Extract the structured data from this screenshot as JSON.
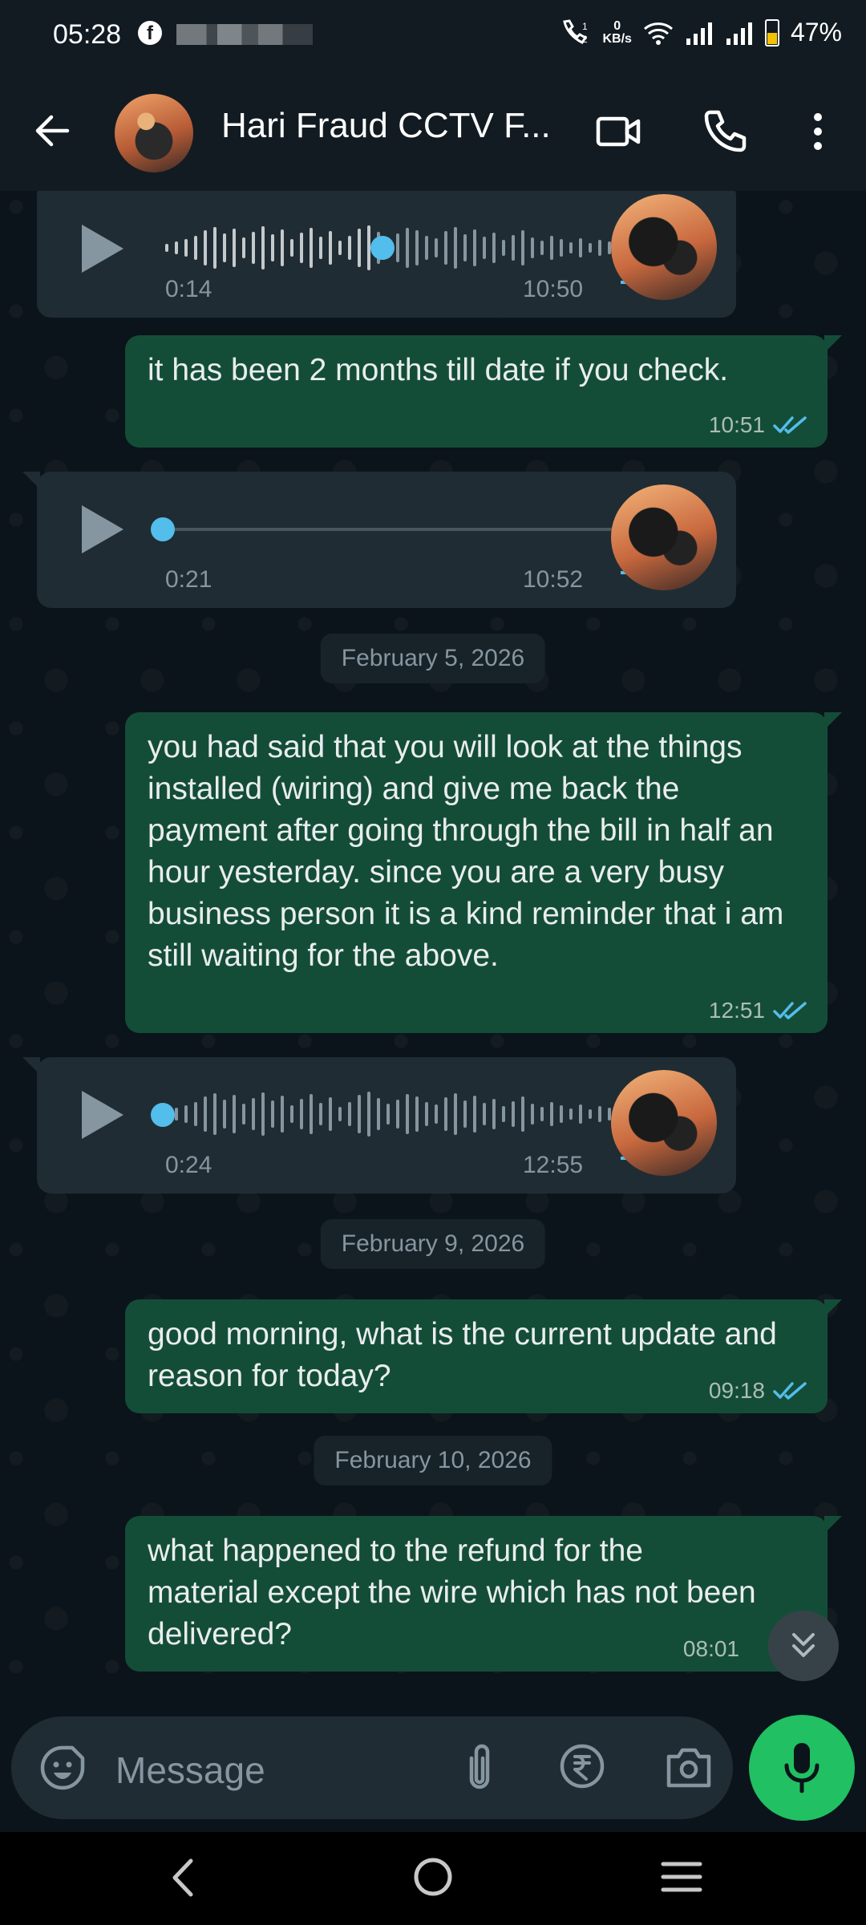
{
  "status_bar": {
    "time": "05:28",
    "network_speed_top": "0",
    "network_speed_unit": "KB/s",
    "battery": "47%",
    "icons": [
      "facebook-icon",
      "wifi-calling-icon",
      "wifi-icon",
      "signal-icon",
      "signal-icon",
      "battery-icon"
    ]
  },
  "header": {
    "title": "Hari Fraud CCTV F...",
    "icons": [
      "back-arrow-icon",
      "video-call-icon",
      "voice-call-icon",
      "more-vert-icon"
    ]
  },
  "messages": [
    {
      "type": "voice",
      "duration": "0:14",
      "time": "10:50",
      "progress": 0.45
    },
    {
      "type": "text",
      "text": "it has been 2 months till date if you check.",
      "time": "10:51",
      "status": "read"
    },
    {
      "type": "voice",
      "duration": "0:21",
      "time": "10:52",
      "progress": 0.0
    },
    {
      "type": "date",
      "text": "February 5, 2026"
    },
    {
      "type": "text",
      "text": "you had said that you will look at the things installed (wiring) and give me back the payment after going through the bill in half an hour yesterday. since you are a very busy business person it is a kind reminder that i am still waiting for the above.",
      "time": "12:51",
      "status": "read"
    },
    {
      "type": "voice",
      "duration": "0:24",
      "time": "12:55",
      "progress": 0.0
    },
    {
      "type": "date",
      "text": "February 9, 2026"
    },
    {
      "type": "text",
      "text": "good morning, what is the current update and reason for today?",
      "time": "09:18",
      "status": "read"
    },
    {
      "type": "date",
      "text": "February 10, 2026"
    },
    {
      "type": "text",
      "text": "what happened to the refund for the material except the wire which has not been delivered?",
      "time": "08:01",
      "status": "read"
    }
  ],
  "composer": {
    "placeholder": "Message",
    "icons": [
      "emoji-sticker-icon",
      "attach-icon",
      "rupee-payment-icon",
      "camera-icon",
      "mic-icon"
    ]
  },
  "colors": {
    "background": "#0b141a",
    "outgoing_bubble": "#144d37",
    "incoming_bubble": "#202c33",
    "accent_green": "#21c063",
    "read_ticks": "#53bdeb"
  }
}
